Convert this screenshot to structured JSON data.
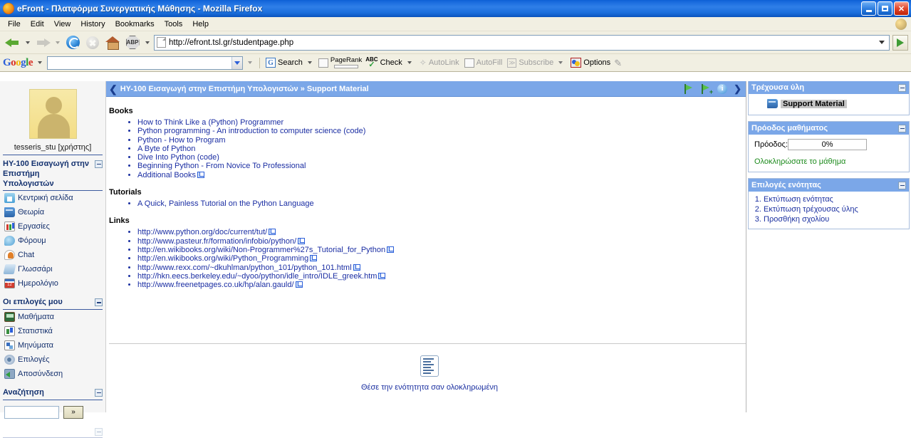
{
  "window": {
    "title": "eFront - Πλατφόρμα Συνεργατικής Μάθησης - Mozilla Firefox",
    "minimize": "",
    "maximize": "",
    "close": "✕"
  },
  "menubar": {
    "items": [
      "File",
      "Edit",
      "View",
      "History",
      "Bookmarks",
      "Tools",
      "Help"
    ]
  },
  "navbar": {
    "url": "http://efront.tsl.gr/studentpage.php",
    "abp_label": "ABP"
  },
  "google_toolbar": {
    "logo": "Google",
    "search_value": "",
    "search_label": "Search",
    "pagerank_label": "PageRank",
    "check_label": "Check",
    "autolink_label": "AutoLink",
    "autofill_label": "AutoFill",
    "subscribe_label": "Subscribe",
    "options_label": "Options"
  },
  "sidebar": {
    "username": "tesseris_stu [χρήστης]",
    "course_title": "ΗΥ-100 Εισαγωγή στην Επιστήμη Υπολογιστών",
    "course_items": [
      {
        "label": "Κεντρική σελίδα",
        "icon": "home-icon"
      },
      {
        "label": "Θεωρία",
        "icon": "book-icon"
      },
      {
        "label": "Εργασίες",
        "icon": "assignments-icon"
      },
      {
        "label": "Φόρουμ",
        "icon": "forum-icon"
      },
      {
        "label": "Chat",
        "icon": "chat-icon"
      },
      {
        "label": "Γλωσσάρι",
        "icon": "glossary-icon"
      },
      {
        "label": "Ημερολόγιο",
        "icon": "calendar-icon"
      }
    ],
    "my_options_title": "Οι επιλογές μου",
    "my_options_items": [
      {
        "label": "Μαθήματα",
        "icon": "courses-icon"
      },
      {
        "label": "Στατιστικά",
        "icon": "statistics-icon"
      },
      {
        "label": "Μηνύματα",
        "icon": "messages-icon"
      },
      {
        "label": "Επιλογές",
        "icon": "options-icon"
      },
      {
        "label": "Αποσύνδεση",
        "icon": "logout-icon"
      }
    ],
    "search_title": "Αναζήτηση",
    "search_value": "",
    "search_button": "»"
  },
  "breadcrumb": {
    "text": "ΗΥ-100 Εισαγωγή στην Επιστήμη Υπολογιστών » Support Material"
  },
  "content": {
    "books_title": "Books",
    "books": [
      {
        "label": "How to Think Like a (Python) Programmer",
        "external": false
      },
      {
        "label": "Python programming - An introduction to computer science (code)",
        "external": false
      },
      {
        "label": "Python - How to Program",
        "external": false
      },
      {
        "label": "A Byte of Python",
        "external": false
      },
      {
        "label": "Dive Into Python (code)",
        "external": false
      },
      {
        "label": "Beginning Python - From Novice To Professional",
        "external": false
      },
      {
        "label": "Additional Books",
        "external": true
      }
    ],
    "tutorials_title": "Tutorials",
    "tutorials": [
      {
        "label": "A Quick, Painless Tutorial on the Python Language",
        "external": false
      }
    ],
    "links_title": "Links",
    "links": [
      {
        "label": "http://www.python.org/doc/current/tut/",
        "external": true
      },
      {
        "label": "http://www.pasteur.fr/formation/infobio/python/",
        "external": true
      },
      {
        "label": "http://en.wikibooks.org/wiki/Non-Programmer%27s_Tutorial_for_Python",
        "external": true
      },
      {
        "label": "http://en.wikibooks.org/wiki/Python_Programming",
        "external": true
      },
      {
        "label": "http://www.rexx.com/~dkuhlman/python_101/python_101.html",
        "external": true
      },
      {
        "label": "http://hkn.eecs.berkeley.edu/~dyoo/python/idle_intro/IDLE_greek.htm",
        "external": true
      },
      {
        "label": "http://www.freenetpages.co.uk/hp/alan.gauld/",
        "external": true
      }
    ],
    "complete_text": "Θέσε την ενότητητα σαν ολοκληρωμένη"
  },
  "right": {
    "current_panel_title": "Τρέχουσα ύλη",
    "current_item": "Support Material",
    "progress_panel_title": "Πρόοδος μαθήματος",
    "progress_label": "Πρόοδος:",
    "progress_value": "0%",
    "progress_link": "Ολοκληρώσατε το μάθημα",
    "options_panel_title": "Επιλογές ενότητας",
    "options": [
      "Εκτύπωση ενότητας",
      "Εκτύπωση τρέχουσας ύλης",
      "Προσθήκη σχολίου"
    ]
  },
  "colors": {
    "title_blue": "#1668dc",
    "header_blue": "#7ba7e8",
    "link_blue": "#1b2ea3",
    "green_link": "#1d8b1d",
    "toolbar_bg": "#f1efe2"
  }
}
